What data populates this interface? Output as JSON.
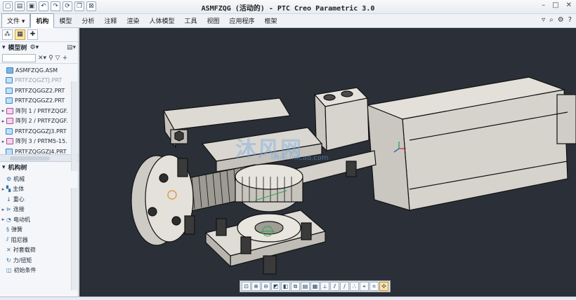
{
  "window": {
    "title": "ASMFZQG (活动的) - PTC Creo Parametric 3.0",
    "controls": [
      "–",
      "□",
      "✕"
    ]
  },
  "quick_access": [
    "new-icon",
    "open-icon",
    "save-icon",
    "undo-icon",
    "redo-icon",
    "regenerate-icon",
    "windows-icon",
    "close-window-icon"
  ],
  "ribbon": {
    "file_tab": "文件",
    "tabs": [
      "机构",
      "模型",
      "分析",
      "注释",
      "渲染",
      "人体模型",
      "工具",
      "视图",
      "应用程序",
      "框架"
    ],
    "active_tab": "机构"
  },
  "model_tree": {
    "header": "模型树",
    "root": "ASMFZQG.ASM",
    "items": [
      {
        "label": "PRTFZQGZTJ.PRT",
        "type": "part",
        "dim": true
      },
      {
        "label": "PRTFZQGGZ2.PRT",
        "type": "part"
      },
      {
        "label": "PRTFZQGGZ2.PRT",
        "type": "part"
      },
      {
        "label": "阵列 1 / PRTFZQGF.",
        "type": "pattern"
      },
      {
        "label": "阵列 2 / PRTFZQGF.",
        "type": "pattern"
      },
      {
        "label": "PRTFZQGGZJ3.PRT",
        "type": "part"
      },
      {
        "label": "阵列 3 / PRTM5-15.",
        "type": "pattern"
      },
      {
        "label": "PRTFZQGGZJ4.PRT",
        "type": "part"
      }
    ]
  },
  "mechanism_tree": {
    "header": "机构树",
    "root": "机械",
    "items": [
      "主体",
      "重心",
      "连接",
      "电动机",
      "弹簧",
      "阻尼器",
      "衬套载荷",
      "力/扭矩",
      "初始条件"
    ]
  },
  "watermark": {
    "text": "沐风网",
    "url": "www.mfcad.com"
  },
  "colors": {
    "viewport_bg": "#2b3038",
    "part_fill": "#d8d6cf",
    "part_edge": "#121212"
  }
}
